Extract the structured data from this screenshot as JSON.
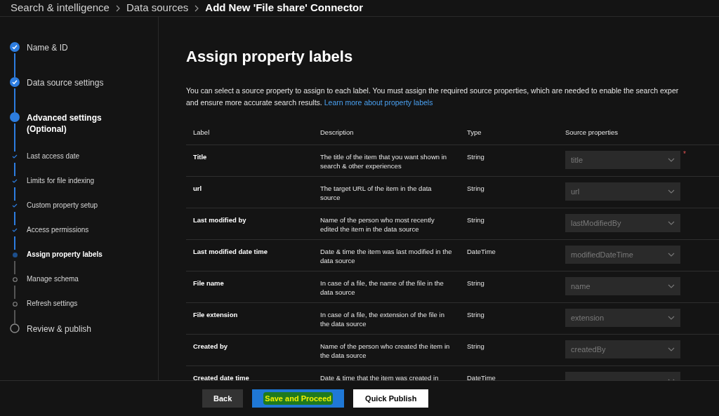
{
  "breadcrumb": [
    {
      "label": "Search & intelligence",
      "current": false
    },
    {
      "label": "Data sources",
      "current": false
    },
    {
      "label": "Add New 'File share' Connector",
      "current": true
    }
  ],
  "steps": [
    {
      "label": "Name & ID",
      "completed": true,
      "current": false
    },
    {
      "label": "Data source settings",
      "completed": true,
      "current": false
    },
    {
      "label": "Advanced settings (Optional)",
      "completed": false,
      "current": true,
      "children": [
        {
          "label": "Last access date",
          "completed": true,
          "current": false
        },
        {
          "label": "Limits for file indexing",
          "completed": true,
          "current": false
        },
        {
          "label": "Custom property setup",
          "completed": true,
          "current": false
        },
        {
          "label": "Access permissions",
          "completed": true,
          "current": false
        },
        {
          "label": "Assign property labels",
          "completed": false,
          "current": true
        },
        {
          "label": "Manage schema",
          "completed": false,
          "current": false
        },
        {
          "label": "Refresh settings",
          "completed": false,
          "current": false
        }
      ]
    },
    {
      "label": "Review & publish",
      "completed": false,
      "current": false
    }
  ],
  "page_title": "Assign property labels",
  "intro_lines": [
    "You can select a source property to assign to each label. You must assign the required source properties, which are needed to enable the search exper",
    "and ensure more accurate search results."
  ],
  "intro_link": "Learn more about property labels",
  "table": {
    "columns": [
      "Label",
      "Description",
      "Type",
      "Source properties"
    ],
    "rows": [
      {
        "label": "Title",
        "description": "The title of the item that you want shown in search & other experiences",
        "type": "String",
        "source": "title",
        "required_mark": "*"
      },
      {
        "label": "url",
        "description": "The target URL of the item in the data source",
        "type": "String",
        "source": "url"
      },
      {
        "label": "Last modified by",
        "description": "Name of the person who most recently edited the item in the data source",
        "type": "String",
        "source": "lastModifiedBy"
      },
      {
        "label": "Last modified date time",
        "description": "Date & time the item was last modified in the data source",
        "type": "DateTime",
        "source": "modifiedDateTime"
      },
      {
        "label": "File name",
        "description": "In case of a file, the name of the file in the data source",
        "type": "String",
        "source": "name"
      },
      {
        "label": "File extension",
        "description": "In case of a file, the extension of the file in the data source",
        "type": "String",
        "source": "extension"
      },
      {
        "label": "Created by",
        "description": "Name of the person who created the item in the data source",
        "type": "String",
        "source": "createdBy"
      },
      {
        "label": "Created date time",
        "description": "Date & time that the item was created in",
        "type": "DateTime"
      }
    ]
  },
  "buttons": [
    {
      "label": "Back",
      "kind": "secondary"
    },
    {
      "label": "Save and Proceed",
      "kind": "primary"
    },
    {
      "label": "Quick Publish",
      "kind": "outline"
    }
  ]
}
